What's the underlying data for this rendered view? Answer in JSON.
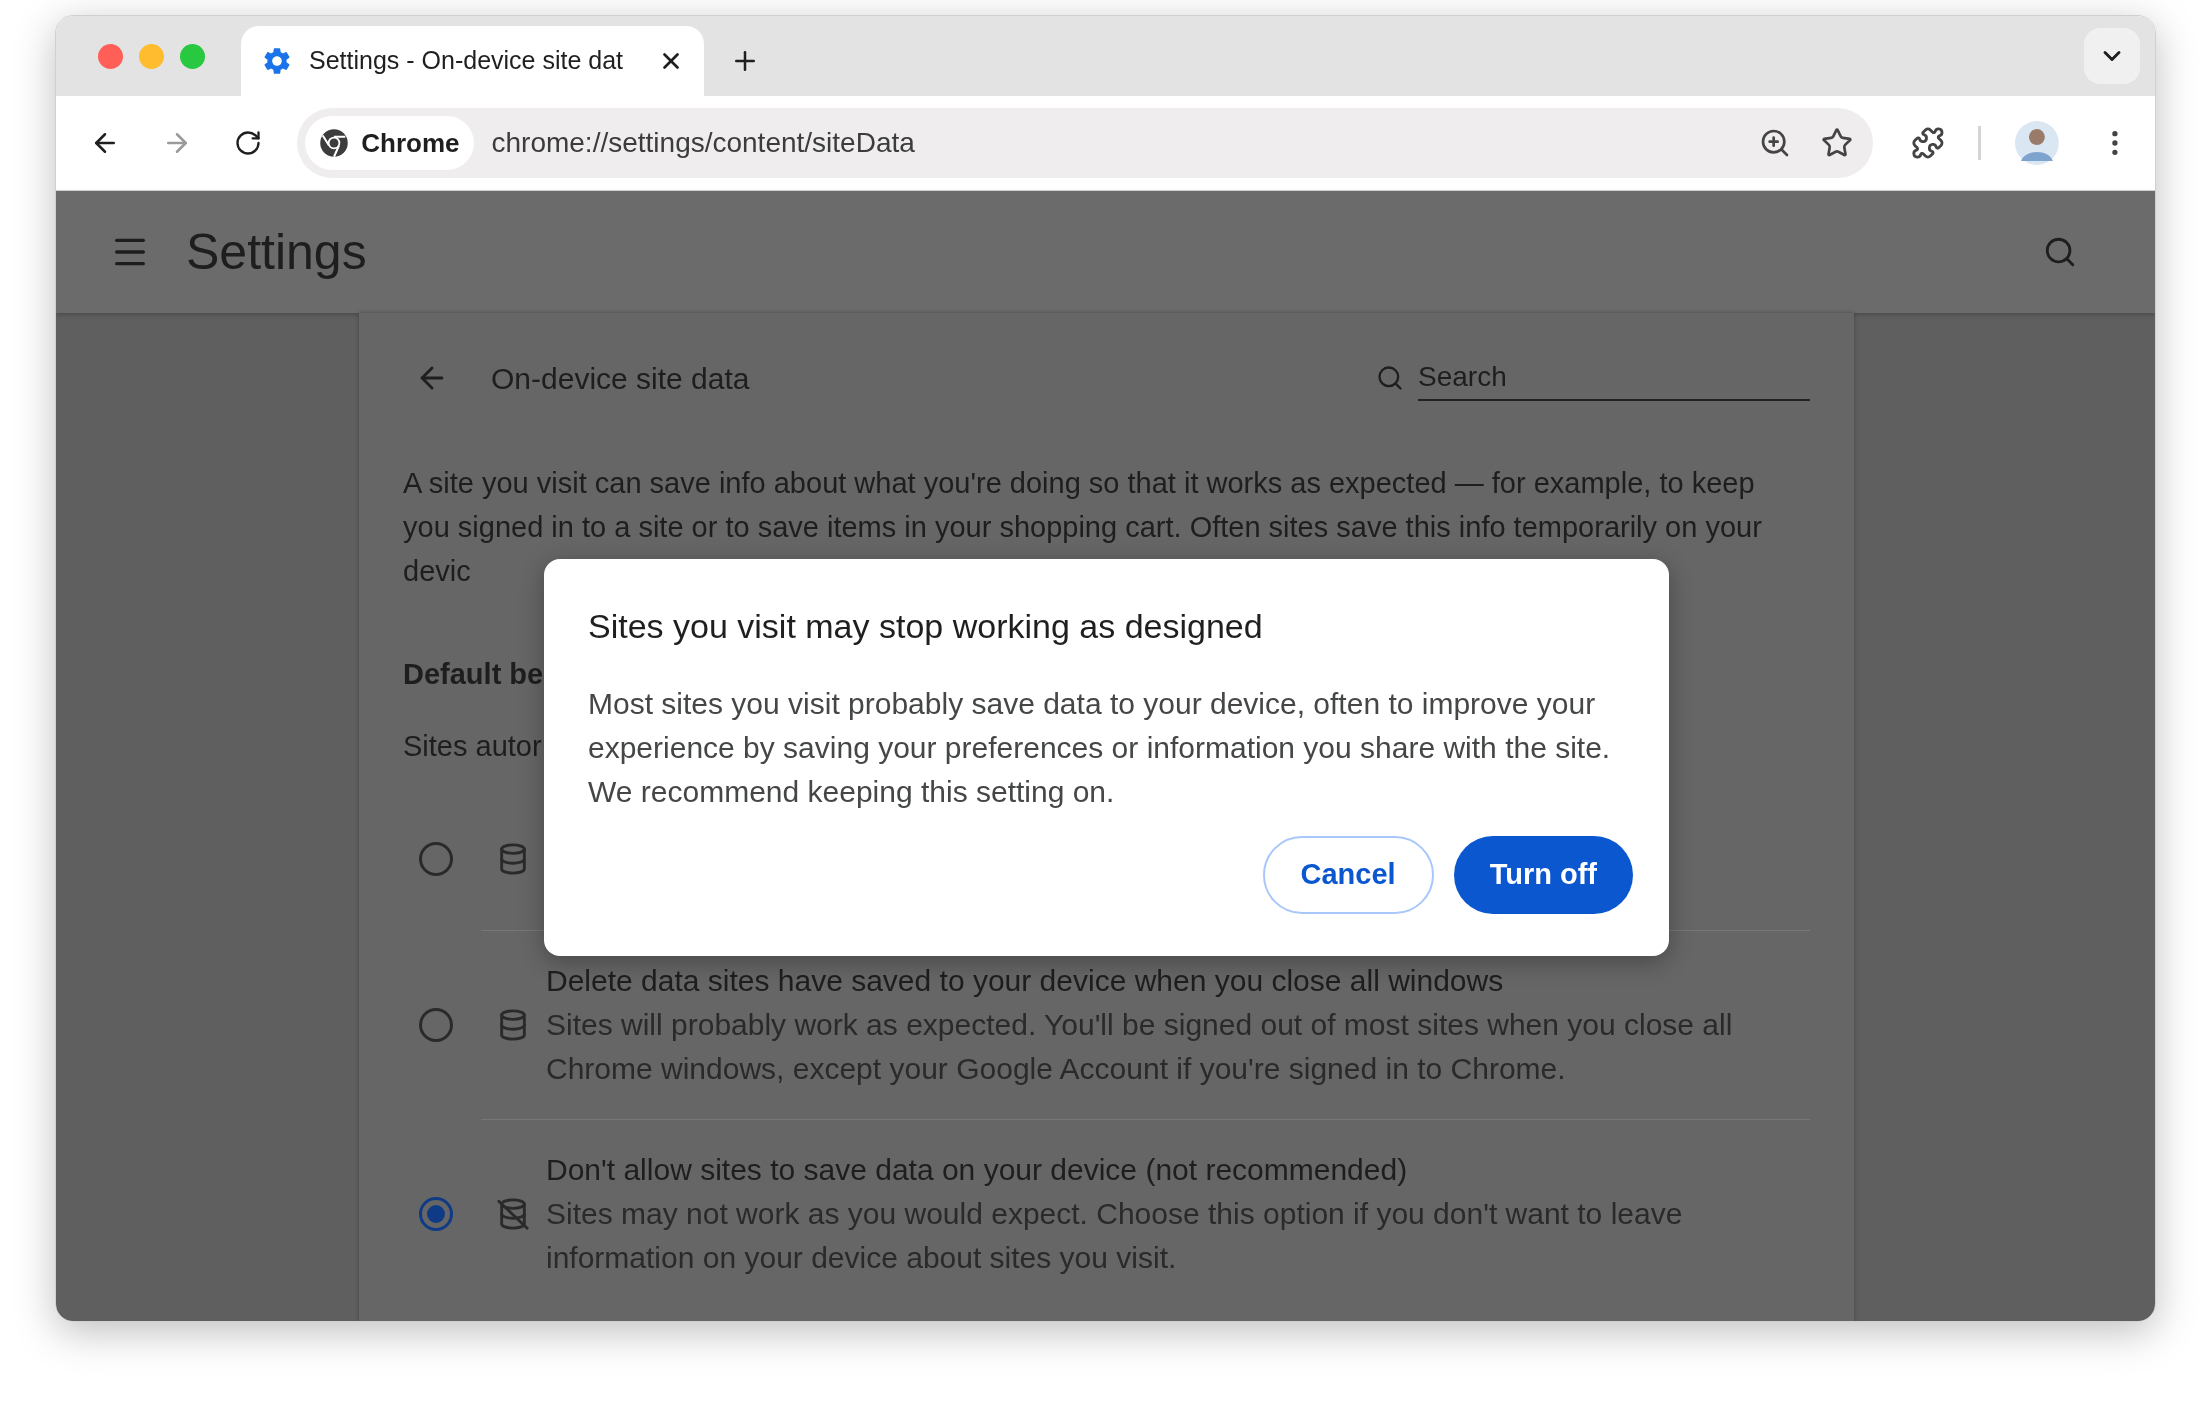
{
  "browser": {
    "tab": {
      "title": "Settings - On-device site dat",
      "selected": true
    },
    "omnibox": {
      "chip": "Chrome",
      "url": "chrome://settings/content/siteData"
    }
  },
  "settings_header": {
    "title": "Settings"
  },
  "page": {
    "title": "On-device site data",
    "search": {
      "placeholder": "Search"
    },
    "description": "A site you visit can save info about what you're doing so that it works as expected — for example, to keep you signed in to a site or to save items in your shopping cart. Often sites save this info temporarily on your devic",
    "section_heading": "Default be",
    "section_text": "Sites autor",
    "options": [
      {
        "kind": "database",
        "selected": false
      },
      {
        "kind": "database",
        "selected": false,
        "title": "Delete data sites have saved to your device when you close all windows",
        "description": "Sites will probably work as expected. You'll be signed out of most sites when you close all Chrome windows, except your Google Account if you're signed in to Chrome."
      },
      {
        "kind": "database-off",
        "selected": true,
        "title": "Don't allow sites to save data on your device (not recommended)",
        "description": "Sites may not work as you would expect. Choose this option if you don't want to leave information on your device about sites you visit."
      }
    ]
  },
  "dialog": {
    "title": "Sites you visit may stop working as designed",
    "body": "Most sites you visit probably save data to your device, often to improve your experience by saving your preferences or information you share with the site. We recommend keeping this setting on.",
    "buttons": [
      {
        "label": "Cancel",
        "kind": "outlined"
      },
      {
        "label": "Turn off",
        "kind": "filled"
      }
    ]
  }
}
